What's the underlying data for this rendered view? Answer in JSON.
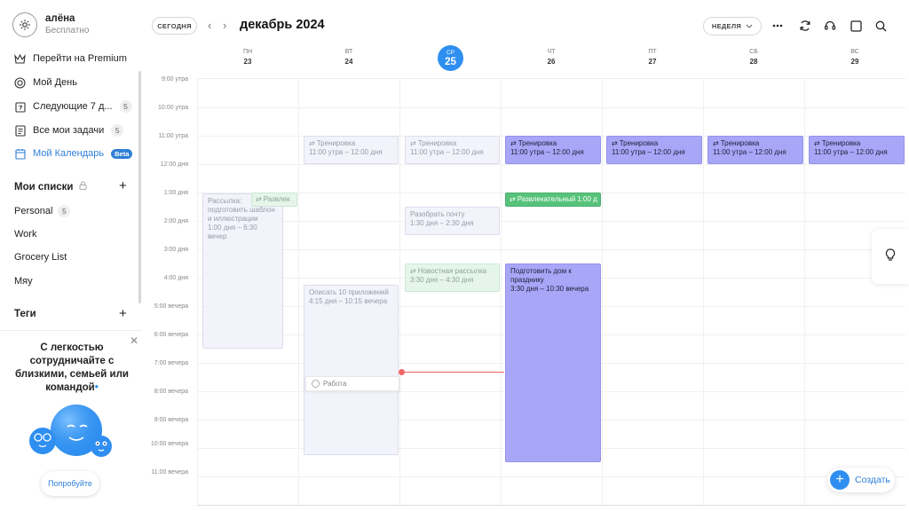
{
  "profile": {
    "name": "алёна",
    "plan": "Бесплатно"
  },
  "nav": [
    {
      "label": "Перейти на Premium",
      "icon": "crown-icon"
    },
    {
      "label": "Мой День",
      "icon": "target-icon"
    },
    {
      "label": "Следующие 7 д...",
      "icon": "calendar-seven-icon",
      "count": "5"
    },
    {
      "label": "Все мои задачи",
      "icon": "list-icon",
      "count": "5"
    },
    {
      "label": "Мой Календарь",
      "icon": "calendar-icon",
      "badge": "Beta"
    }
  ],
  "lists": {
    "title": "Мои списки",
    "items": [
      {
        "label": "Personal",
        "count": "5"
      },
      {
        "label": "Work"
      },
      {
        "label": "Grocery List"
      },
      {
        "label": "Мяу"
      }
    ]
  },
  "tags": {
    "title": "Теги"
  },
  "promo": {
    "text": "С легкостью сотрудничайте с близкими, семьей или командой",
    "button": "Попробуйте"
  },
  "header": {
    "today": "СЕГОДНЯ",
    "month": "декабрь 2024",
    "view": "НЕДЕЛЯ"
  },
  "days": [
    {
      "dow": "ПН",
      "num": "23"
    },
    {
      "dow": "ВТ",
      "num": "24"
    },
    {
      "dow": "СР",
      "num": "25"
    },
    {
      "dow": "ЧТ",
      "num": "26"
    },
    {
      "dow": "ПТ",
      "num": "27"
    },
    {
      "dow": "СБ",
      "num": "28"
    },
    {
      "dow": "ВС",
      "num": "29"
    }
  ],
  "times": [
    "9:00 утра",
    "10:00 утра",
    "11:00 утра",
    "12:00 дня",
    "1:00 дня",
    "2:00 дня",
    "3:00 дня",
    "4:00 дня",
    "5:00 вечера",
    "6:00 вечера",
    "7:00 вечера",
    "8:00 вечера",
    "9:00 вечера",
    "10:00 вечера",
    "11:00 вечера"
  ],
  "events": {
    "training": {
      "title": "Тренировка",
      "time": "11:00 утра – 12:00 дня"
    },
    "mailing": {
      "title": "Рассылка: подготовить шаблон и иллюстрации",
      "time": "1:00 дня – 6:30 вечер"
    },
    "fun_short": {
      "title": "Развлек"
    },
    "fun_thu": {
      "title": "Развлекательный 1:00 д"
    },
    "mail_sort": {
      "title": "Разобрать почту",
      "time": "1:30 дня – 2:30 дня"
    },
    "news": {
      "title": "Новостная рассылка",
      "time": "3:30 дня – 4:30 дня"
    },
    "house": {
      "title": "Подготовить дом к празднику",
      "time": "3:30 дня – 10:30 вечера"
    },
    "describe": {
      "title": "Описать 10 приложений",
      "time": "4:15 дня – 10:15 вечера"
    },
    "work_task": {
      "title": "Работа"
    }
  },
  "create_button": "Создать",
  "colors": {
    "accent": "#2f8ff0",
    "event_purple": "#a8a6f7",
    "event_green": "#57c27a",
    "now_line": "#f06565"
  }
}
